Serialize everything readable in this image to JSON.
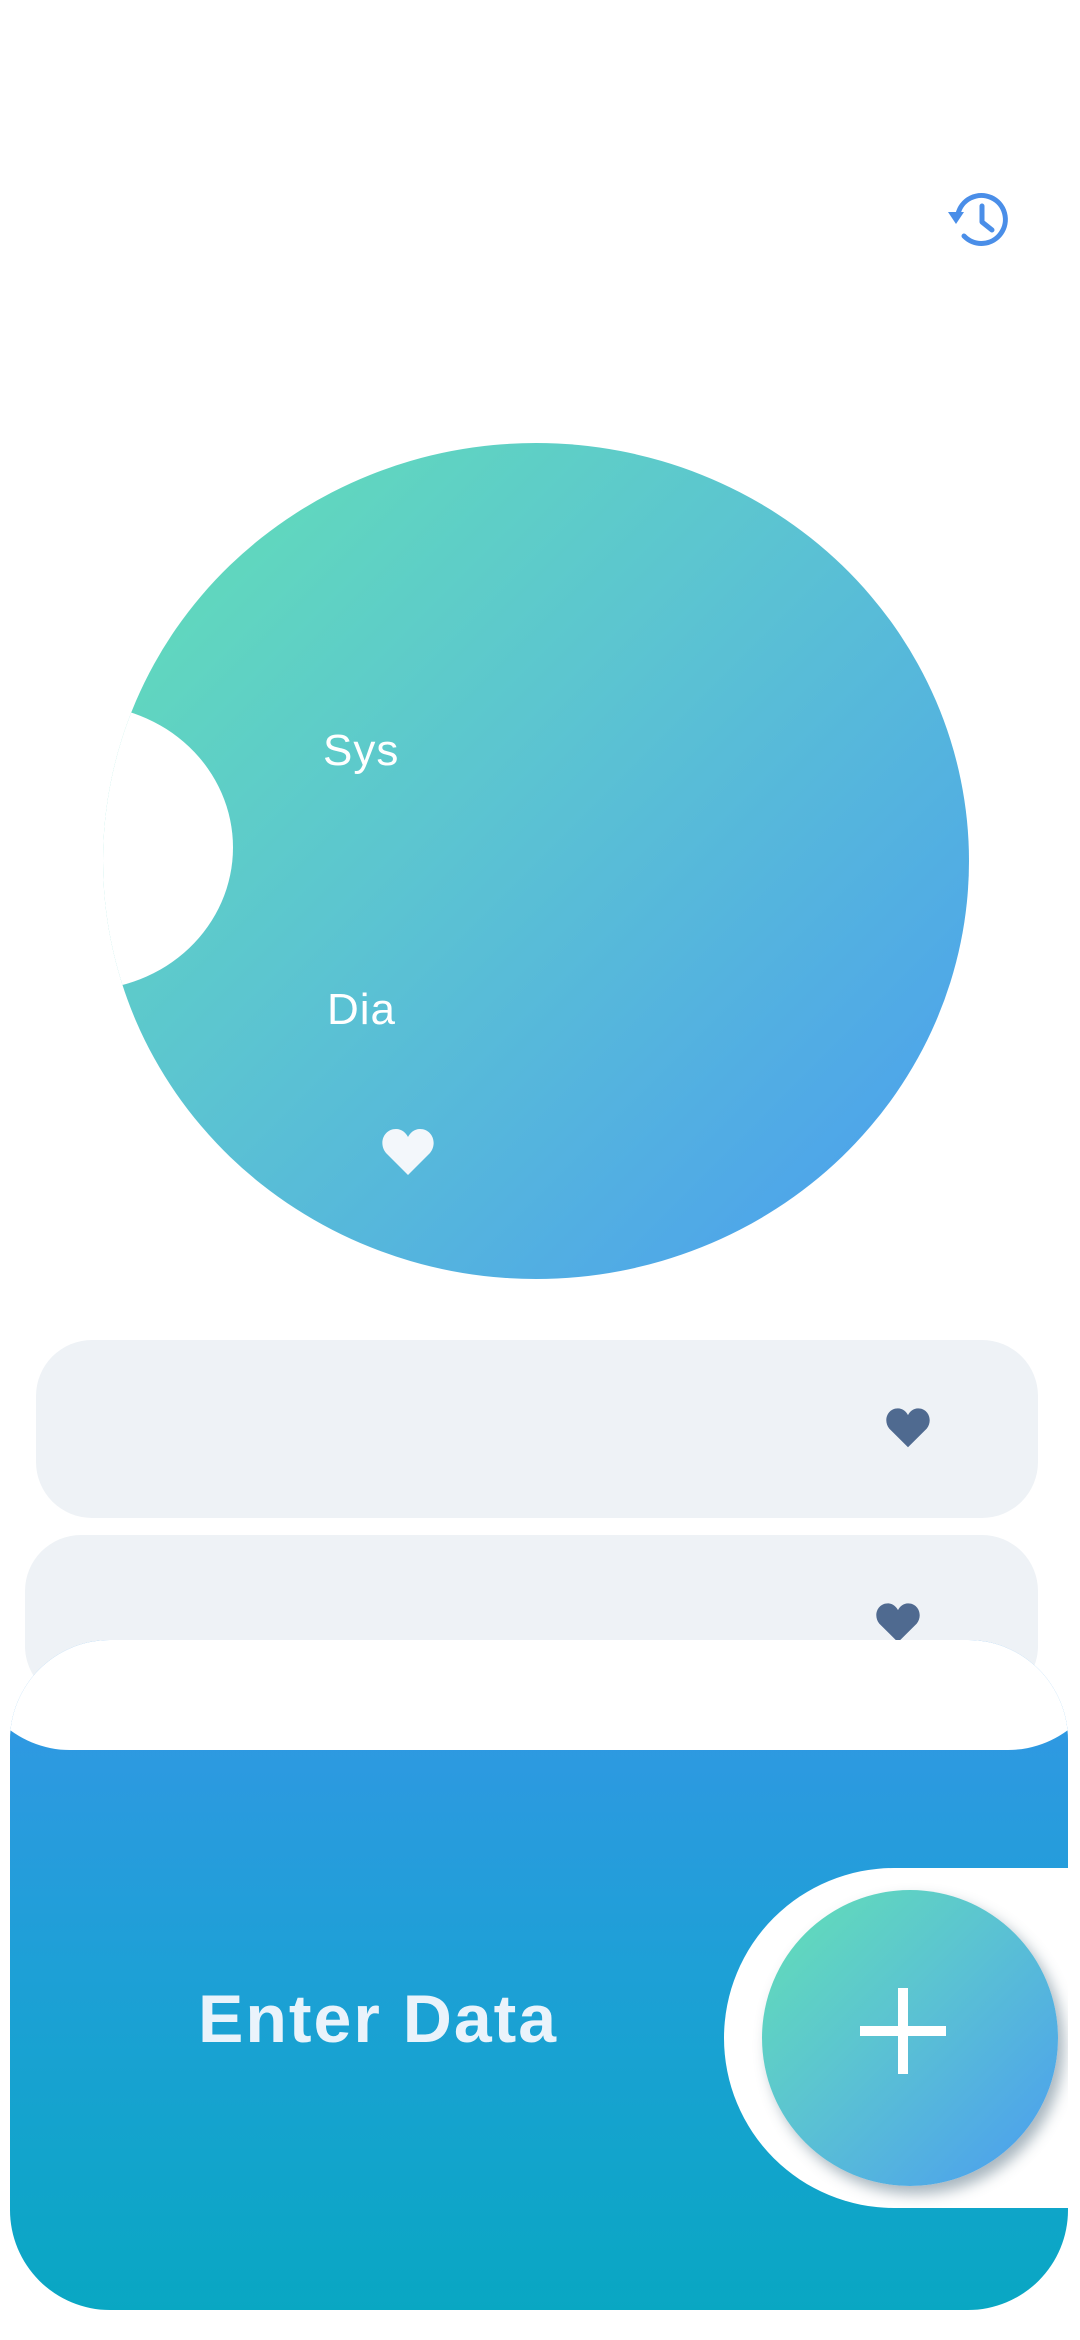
{
  "header": {
    "history_icon": "history-icon"
  },
  "reading": {
    "sys_label": "Sys",
    "dia_label": "Dia",
    "pulse_icon": "heart-icon"
  },
  "rows": [
    {
      "icon": "heart-icon"
    },
    {
      "icon": "heart-icon"
    }
  ],
  "footer": {
    "enter_data_label": "Enter Data",
    "add_icon": "plus-icon"
  },
  "colors": {
    "accent_blue": "#4a8ee8",
    "gradient_start": "#63e0b5",
    "gradient_end": "#4a9cf1",
    "row_background": "#eef2f6",
    "row_heart": "#4f6a90",
    "panel_top": "#3596e6",
    "panel_bottom": "#09a7c3"
  }
}
